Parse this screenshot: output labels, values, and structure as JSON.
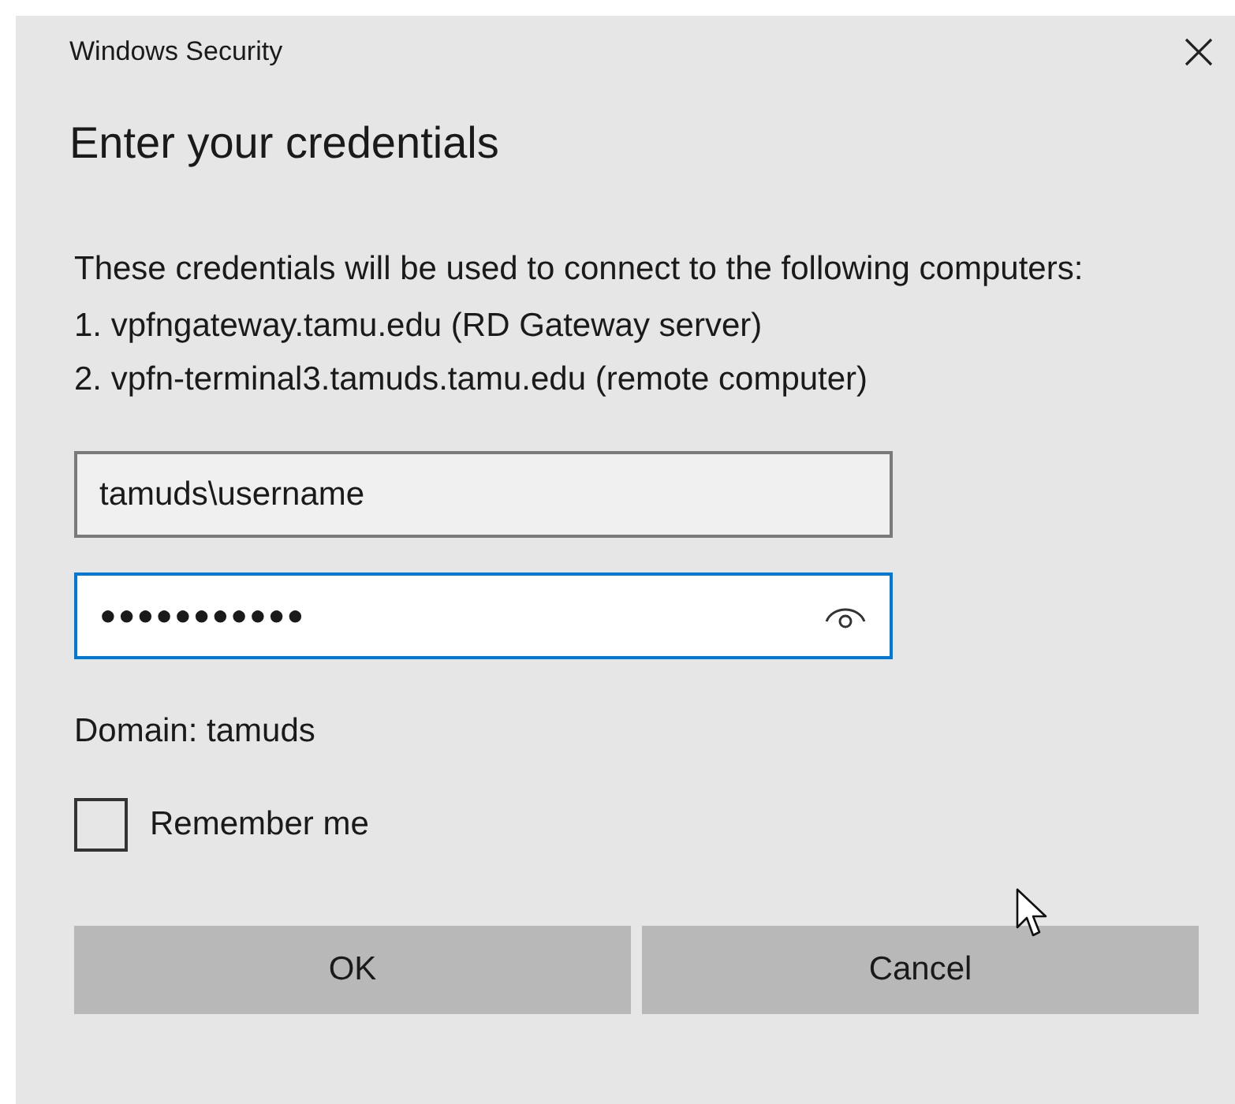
{
  "window": {
    "title": "Windows Security"
  },
  "heading": "Enter your credentials",
  "message": "These credentials will be used to connect to the following computers:",
  "computers": [
    "1. vpfngateway.tamu.edu (RD Gateway server)",
    "2. vpfn-terminal3.tamuds.tamu.edu (remote computer)"
  ],
  "username_field": {
    "value": "tamuds\\username",
    "focused": false
  },
  "password_field": {
    "value": "●●●●●●●●●●●",
    "focused": true
  },
  "domain": "Domain: tamuds",
  "remember_me": {
    "label": "Remember me",
    "checked": false
  },
  "buttons": [
    "OK",
    "Cancel"
  ]
}
